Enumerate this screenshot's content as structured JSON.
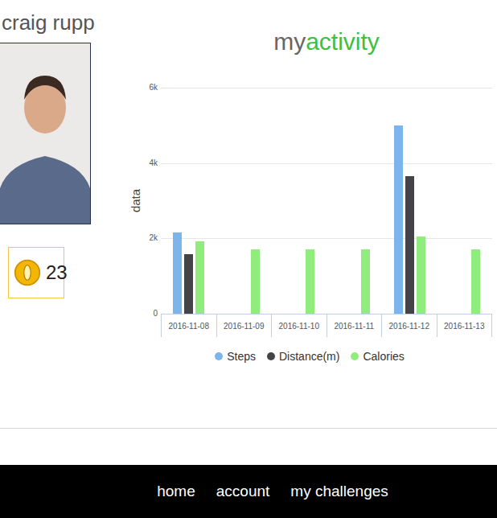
{
  "user": {
    "name": "craig rupp",
    "coins": "23"
  },
  "title": {
    "prefix": "my",
    "accent": "activity"
  },
  "chart": {
    "y_label": "data",
    "ticks": [
      "6k",
      "4k",
      "2k",
      "0"
    ],
    "categories": [
      "2016-11-08",
      "2016-11-09",
      "2016-11-10",
      "2016-11-11",
      "2016-11-12",
      "2016-11-13"
    ],
    "series": [
      {
        "name": "Steps",
        "color": "#7cb5ec",
        "values": [
          2150,
          0,
          0,
          0,
          5000,
          0
        ]
      },
      {
        "name": "Distance(m)",
        "color": "#434348",
        "values": [
          1570,
          0,
          0,
          0,
          3650,
          0
        ]
      },
      {
        "name": "Calories",
        "color": "#90ed7d",
        "values": [
          1920,
          1700,
          1700,
          1700,
          2050,
          1700
        ]
      }
    ]
  },
  "nav": [
    "home",
    "account",
    "my challenges"
  ]
}
